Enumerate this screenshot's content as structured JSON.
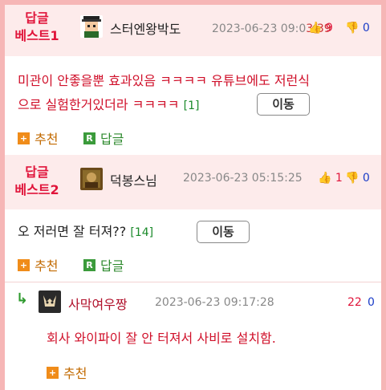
{
  "comments": [
    {
      "best_label_1": "답글",
      "best_label_2": "베스트1",
      "nickname": "스터엔왕박도",
      "date": "2023-06-23 09:0",
      "date_tail": "3:39",
      "upvotes": "9",
      "downvotes": "0",
      "body_line1": "미관이 안좋을뿐 효과있음 ㅋㅋㅋㅋ 유튜브에도 저런식",
      "body_line2": "으로 실험한거있더라 ㅋㅋㅋㅋ",
      "reply_count": "[1]",
      "move_label": "이동",
      "recommend_label": "추천",
      "reply_label": "답글"
    },
    {
      "best_label_1": "답글",
      "best_label_2": "베스트2",
      "nickname": "덕봉스님",
      "date": "2023-06-23 05:15:25",
      "upvotes": "1",
      "downvotes": "0",
      "body_line1": "오 저러면 잘 터져??",
      "reply_count": "[14]",
      "move_label": "이동",
      "recommend_label": "추천",
      "reply_label": "답글"
    }
  ],
  "reply": {
    "nickname": "사막여우짱",
    "date": "2023-06-23 09:17:28",
    "upvotes": "22",
    "downvotes": "0",
    "body": "회사 와이파이 잘 안 터져서 사비로 설치함.",
    "recommend_label": "추천"
  },
  "icons": {
    "plus": "+",
    "reply_badge": "R",
    "thumb_up": "👍",
    "thumb_down": "👎",
    "reply_arrow": "↳"
  },
  "colors": {
    "frame_border": "#f6b6b6",
    "header_bg": "#fdebeb",
    "best_red": "#e0143a",
    "down_blue": "#1a3cc8"
  }
}
